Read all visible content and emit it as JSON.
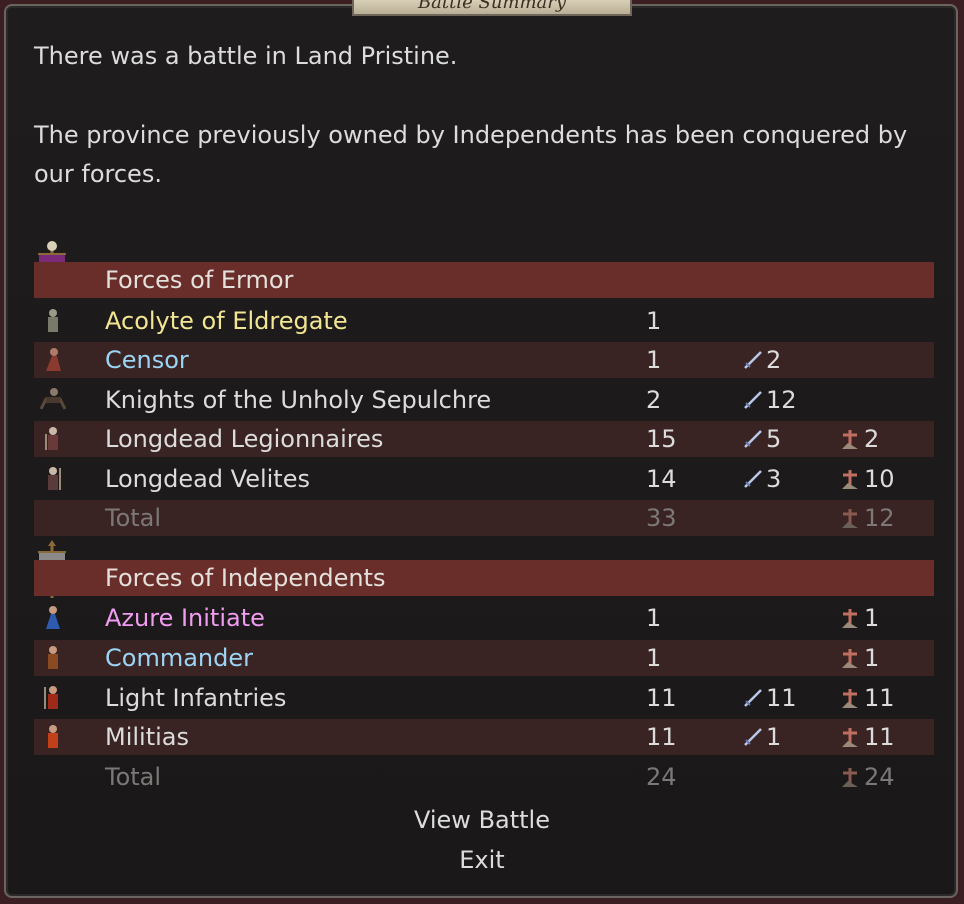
{
  "window": {
    "title": "Battle Summary"
  },
  "message": {
    "line1": "There was a battle in Land Pristine.",
    "line2": "The province previously owned by Independents has been conquered by our forces."
  },
  "sections": [
    {
      "header": "Forces of Ermor",
      "banner_color": "#7a2a78",
      "rows": [
        {
          "name": "Acolyte of Eldregate",
          "color": "#f2e694",
          "count": "1",
          "kills": "",
          "losses": ""
        },
        {
          "name": "Censor",
          "color": "#9bd4f4",
          "count": "1",
          "kills": "2",
          "losses": ""
        },
        {
          "name": "Knights of the Unholy Sepulchre",
          "color": "#dcdcdc",
          "count": "2",
          "kills": "12",
          "losses": ""
        },
        {
          "name": "Longdead Legionnaires",
          "color": "#dcdcdc",
          "count": "15",
          "kills": "5",
          "losses": "2"
        },
        {
          "name": "Longdead Velites",
          "color": "#dcdcdc",
          "count": "14",
          "kills": "3",
          "losses": "10"
        }
      ],
      "total": {
        "label": "Total",
        "count": "33",
        "losses": "12"
      }
    },
    {
      "header": "Forces of Independents",
      "banner_color": "#8a8a8a",
      "rows": [
        {
          "name": "Azure Initiate",
          "color": "#f09cf0",
          "count": "1",
          "kills": "",
          "losses": "1"
        },
        {
          "name": "Commander",
          "color": "#9bd4f4",
          "count": "1",
          "kills": "",
          "losses": "1"
        },
        {
          "name": "Light Infantries",
          "color": "#dcdcdc",
          "count": "11",
          "kills": "11",
          "losses": "11"
        },
        {
          "name": "Militias",
          "color": "#dcdcdc",
          "count": "11",
          "kills": "1",
          "losses": "11"
        }
      ],
      "total": {
        "label": "Total",
        "count": "24",
        "losses": "24"
      }
    }
  ],
  "icons": {
    "kills": "sword-icon",
    "losses": "grave-marker-icon"
  },
  "buttons": {
    "view_battle": "View Battle",
    "exit": "Exit"
  }
}
